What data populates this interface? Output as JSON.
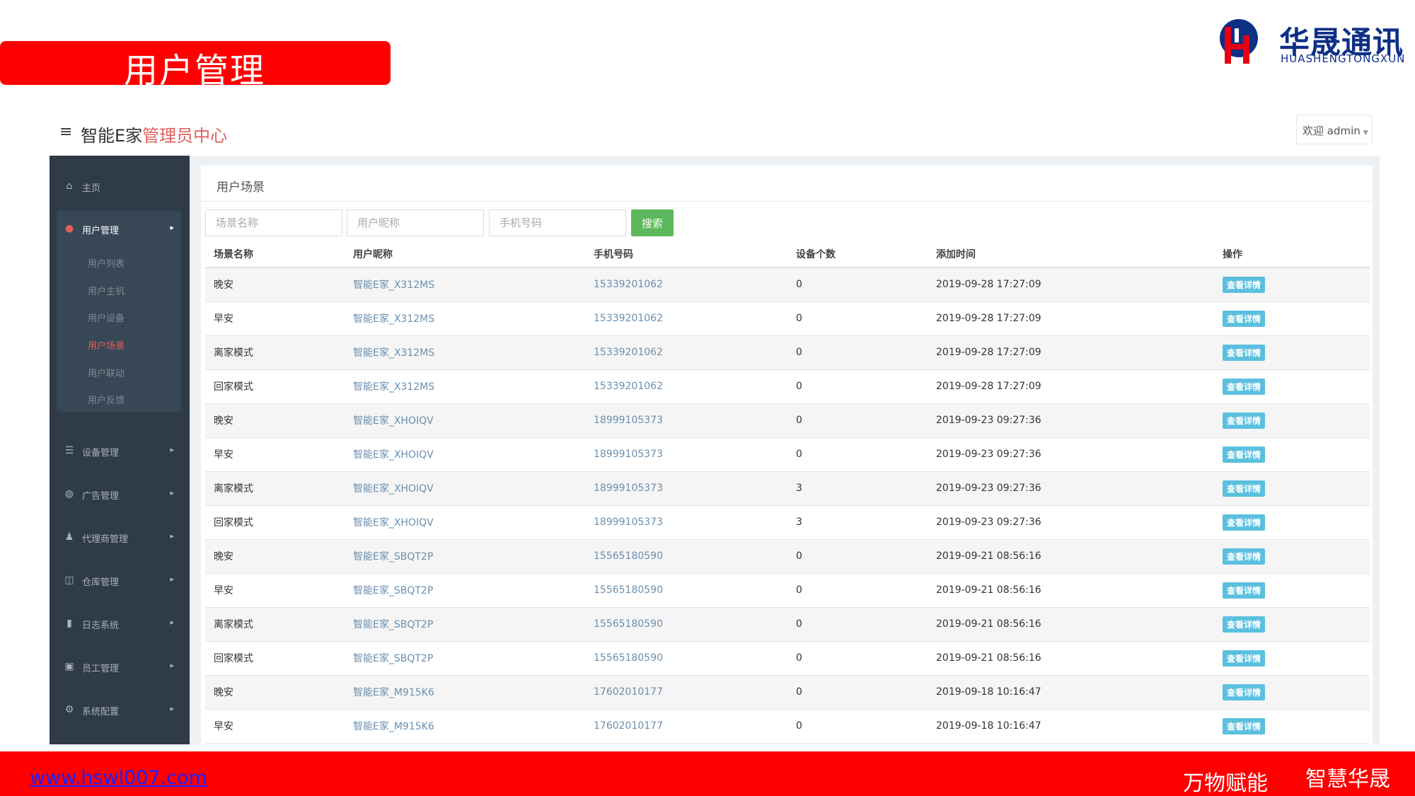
{
  "slide": {
    "title": "用户管理",
    "logo_cn": "华晟通讯",
    "logo_en": "HUASHENGTONGXUN",
    "footer_url": "www.hswl007.com",
    "footer_slogan_1": "万物赋能",
    "footer_slogan_2": "智慧华晟"
  },
  "header": {
    "brand_prefix": "智能E家",
    "brand_accent": "管理员中心",
    "welcome": "欢迎 admin"
  },
  "sidebar": {
    "items": [
      {
        "label": "主页",
        "icon": "home-icon"
      },
      {
        "label": "用户管理",
        "icon": "user-icon"
      },
      {
        "label": "设备管理",
        "icon": "server-icon"
      },
      {
        "label": "广告管理",
        "icon": "dashboard-icon"
      },
      {
        "label": "代理商管理",
        "icon": "users-icon"
      },
      {
        "label": "仓库管理",
        "icon": "columns-icon"
      },
      {
        "label": "日志系统",
        "icon": "book-icon"
      },
      {
        "label": "员工管理",
        "icon": "id-card-icon"
      },
      {
        "label": "系统配置",
        "icon": "gear-icon"
      }
    ],
    "submenu": [
      "用户列表",
      "用户主机",
      "用户设备",
      "用户场景",
      "用户联动",
      "用户反馈"
    ],
    "active_sub": "用户场景"
  },
  "panel": {
    "title": "用户场景",
    "search": {
      "scene_placeholder": "场景名称",
      "nickname_placeholder": "用户昵称",
      "phone_placeholder": "手机号码",
      "button": "搜索"
    },
    "columns": [
      "场景名称",
      "用户昵称",
      "手机号码",
      "设备个数",
      "添加时间",
      "操作"
    ],
    "rows": [
      {
        "scene": "晚安",
        "nickname": "智能E家_X312MS",
        "phone": "15339201062",
        "devices": "0",
        "time": "2019-09-28 17:27:09",
        "action": "查看详情"
      },
      {
        "scene": "早安",
        "nickname": "智能E家_X312MS",
        "phone": "15339201062",
        "devices": "0",
        "time": "2019-09-28 17:27:09",
        "action": "查看详情"
      },
      {
        "scene": "离家模式",
        "nickname": "智能E家_X312MS",
        "phone": "15339201062",
        "devices": "0",
        "time": "2019-09-28 17:27:09",
        "action": "查看详情"
      },
      {
        "scene": "回家模式",
        "nickname": "智能E家_X312MS",
        "phone": "15339201062",
        "devices": "0",
        "time": "2019-09-28 17:27:09",
        "action": "查看详情"
      },
      {
        "scene": "晚安",
        "nickname": "智能E家_XHOIQV",
        "phone": "18999105373",
        "devices": "0",
        "time": "2019-09-23 09:27:36",
        "action": "查看详情"
      },
      {
        "scene": "早安",
        "nickname": "智能E家_XHOIQV",
        "phone": "18999105373",
        "devices": "0",
        "time": "2019-09-23 09:27:36",
        "action": "查看详情"
      },
      {
        "scene": "离家模式",
        "nickname": "智能E家_XHOIQV",
        "phone": "18999105373",
        "devices": "3",
        "time": "2019-09-23 09:27:36",
        "action": "查看详情"
      },
      {
        "scene": "回家模式",
        "nickname": "智能E家_XHOIQV",
        "phone": "18999105373",
        "devices": "3",
        "time": "2019-09-23 09:27:36",
        "action": "查看详情"
      },
      {
        "scene": "晚安",
        "nickname": "智能E家_SBQT2P",
        "phone": "15565180590",
        "devices": "0",
        "time": "2019-09-21 08:56:16",
        "action": "查看详情"
      },
      {
        "scene": "早安",
        "nickname": "智能E家_SBQT2P",
        "phone": "15565180590",
        "devices": "0",
        "time": "2019-09-21 08:56:16",
        "action": "查看详情"
      },
      {
        "scene": "离家模式",
        "nickname": "智能E家_SBQT2P",
        "phone": "15565180590",
        "devices": "0",
        "time": "2019-09-21 08:56:16",
        "action": "查看详情"
      },
      {
        "scene": "回家模式",
        "nickname": "智能E家_SBQT2P",
        "phone": "15565180590",
        "devices": "0",
        "time": "2019-09-21 08:56:16",
        "action": "查看详情"
      },
      {
        "scene": "晚安",
        "nickname": "智能E家_M915K6",
        "phone": "17602010177",
        "devices": "0",
        "time": "2019-09-18 10:16:47",
        "action": "查看详情"
      },
      {
        "scene": "早安",
        "nickname": "智能E家_M915K6",
        "phone": "17602010177",
        "devices": "0",
        "time": "2019-09-18 10:16:47",
        "action": "查看详情"
      }
    ]
  },
  "colors": {
    "banner_red": "#ff0000",
    "sidebar_bg": "#2f3b47",
    "accent_red": "#e0605c",
    "search_green": "#5cb85c",
    "detail_blue": "#5bc0de",
    "logo_blue": "#0e2f86"
  }
}
